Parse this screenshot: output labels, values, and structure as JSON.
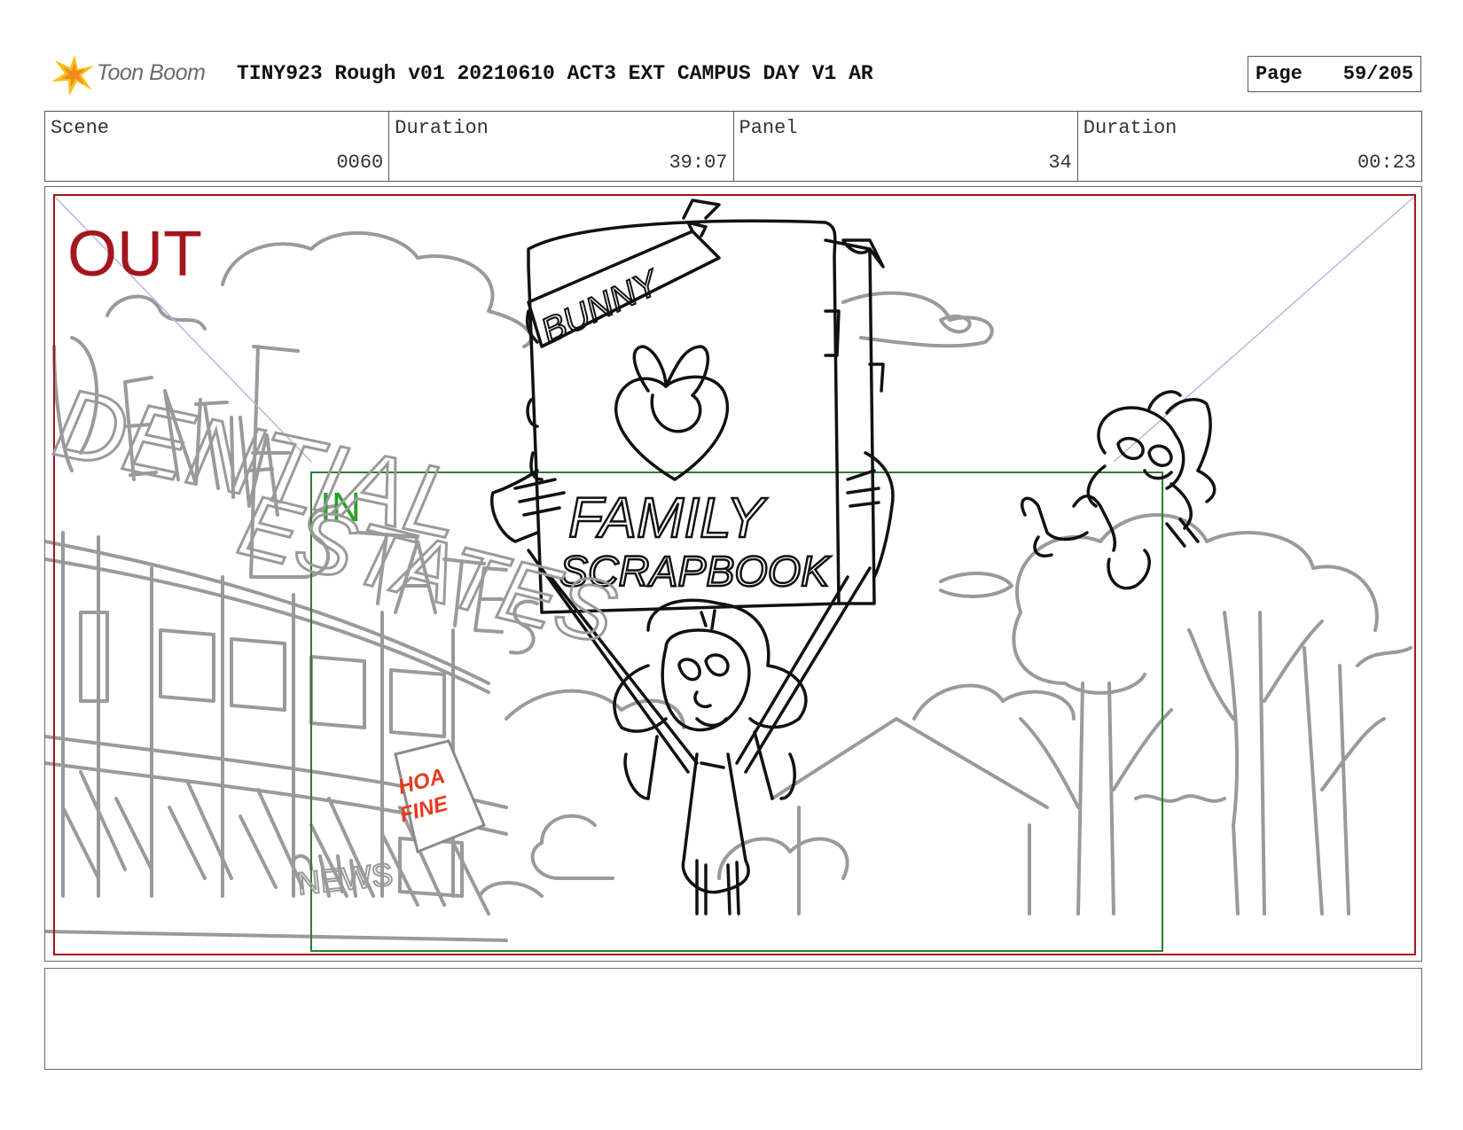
{
  "header": {
    "logo_text": "Toon Boom",
    "title": "TINY923 Rough v01 20210610 ACT3 EXT CAMPUS DAY V1 AR",
    "page_label": "Page",
    "page_value": "59/205"
  },
  "info": [
    {
      "label": "Scene",
      "value": "0060"
    },
    {
      "label": "Duration",
      "value": "39:07"
    },
    {
      "label": "Panel",
      "value": "34"
    },
    {
      "label": "Duration",
      "value": "00:23"
    }
  ],
  "panel": {
    "out_label": "OUT",
    "in_label": "IN",
    "sign_banner": "BUNNY",
    "sign_line1": "FAMILY",
    "sign_line2": "SCRAPBOOK",
    "building_sign_left": "DENTIAL",
    "building_sign_right": "ESTATES",
    "poster_line1": "HOA",
    "poster_line2": "FINE",
    "storefront": "NEWS",
    "colors": {
      "out_frame": "#a3161c",
      "in_frame": "#2e7d32",
      "in_text": "#2aa12a",
      "poster_text": "#e53a1c",
      "sketch_black": "#111111",
      "sketch_grey": "#9a9a9a"
    }
  },
  "notes": ""
}
